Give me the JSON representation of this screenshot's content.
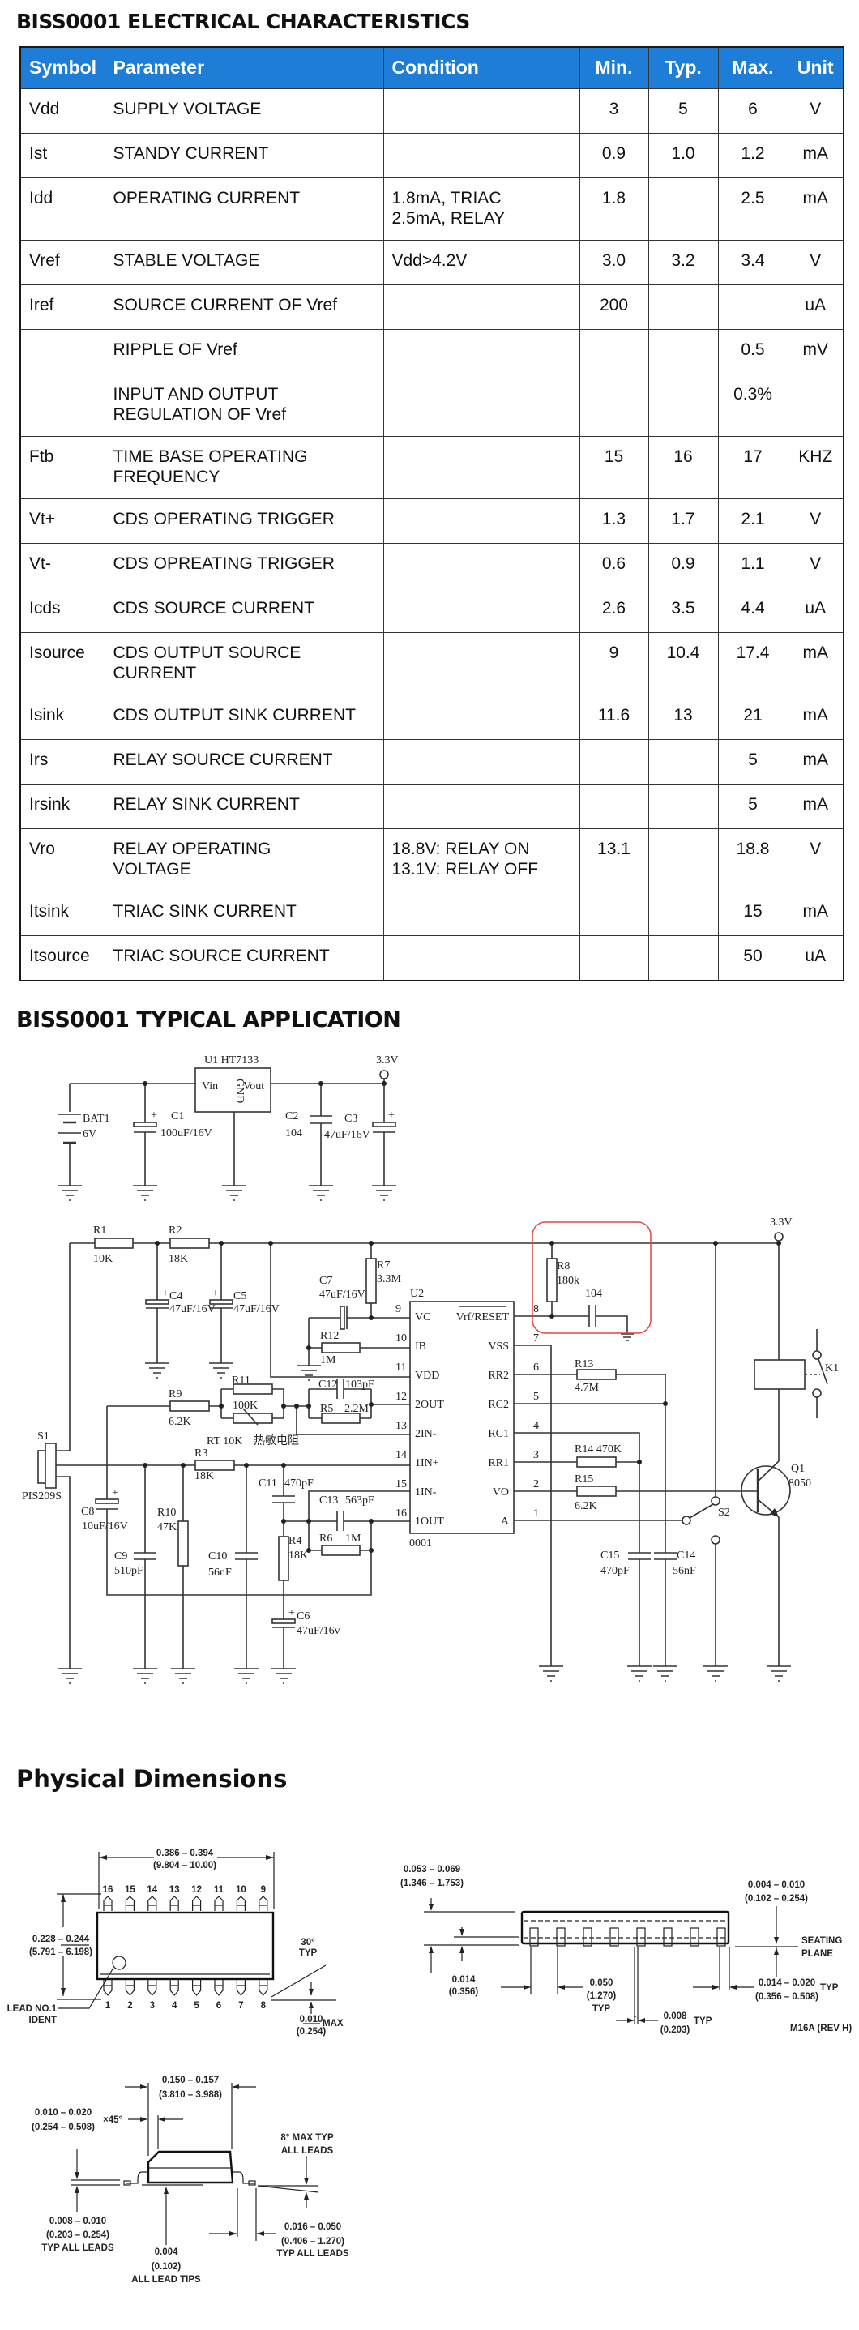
{
  "titles": {
    "electrical": "BISS0001 ELECTRICAL CHARACTERISTICS",
    "application": "BISS0001 TYPICAL APPLICATION",
    "dimensions": "Physical Dimensions"
  },
  "colors": {
    "header_bg": "#1e7dd7",
    "header_text": "#ffffff",
    "highlight_box": "#e0474c"
  },
  "table": {
    "headers": [
      "Symbol",
      "Parameter",
      "Condition",
      "Min.",
      "Typ.",
      "Max.",
      "Unit"
    ],
    "rows": [
      [
        "Vdd",
        "SUPPLY VOLTAGE",
        "",
        "3",
        "5",
        "6",
        "V"
      ],
      [
        "Ist",
        "STANDY CURRENT",
        "",
        "0.9",
        "1.0",
        "1.2",
        "mA"
      ],
      [
        "Idd",
        "OPERATING CURRENT",
        "1.8mA, TRIAC\n2.5mA, RELAY",
        "1.8",
        "",
        "2.5",
        "mA"
      ],
      [
        "Vref",
        "STABLE VOLTAGE",
        "Vdd>4.2V",
        "3.0",
        "3.2",
        "3.4",
        "V"
      ],
      [
        "Iref",
        "SOURCE CURRENT OF Vref",
        "",
        "200",
        "",
        "",
        "uA"
      ],
      [
        "",
        "RIPPLE OF Vref",
        "",
        "",
        "",
        "0.5",
        "mV"
      ],
      [
        "",
        "INPUT AND OUTPUT\nREGULATION OF Vref",
        "",
        "",
        "",
        "0.3%",
        ""
      ],
      [
        "Ftb",
        "TIME BASE OPERATING\nFREQUENCY",
        "",
        "15",
        "16",
        "17",
        "KHZ"
      ],
      [
        "Vt+",
        "CDS OPERATING TRIGGER",
        "",
        "1.3",
        "1.7",
        "2.1",
        "V"
      ],
      [
        "Vt-",
        "CDS OPREATING TRIGGER",
        "",
        "0.6",
        "0.9",
        "1.1",
        "V"
      ],
      [
        "Icds",
        "CDS SOURCE CURRENT",
        "",
        "2.6",
        "3.5",
        "4.4",
        "uA"
      ],
      [
        "Isource",
        "CDS OUTPUT SOURCE\nCURRENT",
        "",
        "9",
        "10.4",
        "17.4",
        "mA"
      ],
      [
        "Isink",
        "CDS OUTPUT SINK CURRENT",
        "",
        "11.6",
        "13",
        "21",
        "mA"
      ],
      [
        "Irs",
        "RELAY SOURCE CURRENT",
        "",
        "",
        "",
        "5",
        "mA"
      ],
      [
        "Irsink",
        "RELAY SINK CURRENT",
        "",
        "",
        "",
        "5",
        "mA"
      ],
      [
        "Vro",
        "RELAY OPERATING\nVOLTAGE",
        "18.8V: RELAY ON\n13.1V: RELAY OFF",
        "13.1",
        "",
        "18.8",
        "V"
      ],
      [
        "Itsink",
        "TRIAC SINK CURRENT",
        "",
        "",
        "",
        "15",
        "mA"
      ],
      [
        "Itsource",
        "TRIAC SOURCE CURRENT",
        "",
        "",
        "",
        "50",
        "uA"
      ]
    ]
  },
  "schematic": {
    "u1": "U1  HT7133",
    "vin": "Vin",
    "gnd": "GND",
    "vout": "Vout",
    "v33a": "3.3V",
    "v33b": "3.3V",
    "bat1": "BAT1",
    "bat1_v": "6V",
    "c1": "C1",
    "c1_v": "100uF/16V",
    "c2": "C2",
    "c2_v": "104",
    "c3": "C3",
    "c3_v": "47uF/16V",
    "r1": "R1",
    "r1_v": "10K",
    "r2": "R2",
    "r2_v": "18K",
    "c4": "C4",
    "c4_v": "47uF/16V",
    "c5": "C5",
    "c5_v": "47uF/16V",
    "r7": "R7",
    "r7_v": "3.3M",
    "c7": "C7",
    "c7_v": "47uF/16V",
    "r12": "R12",
    "r12_v": "1M",
    "r9": "R9",
    "r9_v": "6.2K",
    "r11": "R11",
    "r11_v": "100K",
    "rt": "RT 10K",
    "rt_cn": "热敏电阻",
    "c12": "C12",
    "c12_v": "103pF",
    "r5": "R5",
    "r5_v": "2.2M",
    "s1": "S1",
    "s1_v": "PIS209S",
    "r3": "R3",
    "r3_v": "18K",
    "c8": "C8",
    "c8_v": "10uF/16V",
    "c9": "C9",
    "c9_v": "510pF",
    "r10": "R10",
    "r10_v": "47K",
    "c10": "C10",
    "c10_v": "56nF",
    "c11": "C11",
    "c11_v": "470pF",
    "r4": "R4",
    "r4_v": "18K",
    "c6": "C6",
    "c6_v": "47uF/16v",
    "c13": "C13",
    "c13_v": "563pF",
    "r6": "R6",
    "r6_v": "1M",
    "u2": "U2",
    "u2_part": "0001",
    "pins_left": [
      {
        "num": "9",
        "name": "VC"
      },
      {
        "num": "10",
        "name": "IB"
      },
      {
        "num": "11",
        "name": "VDD"
      },
      {
        "num": "12",
        "name": "2OUT"
      },
      {
        "num": "13",
        "name": "2IN-"
      },
      {
        "num": "14",
        "name": "1IN+"
      },
      {
        "num": "15",
        "name": "1IN-"
      },
      {
        "num": "16",
        "name": "1OUT"
      }
    ],
    "pins_right": [
      {
        "num": "8",
        "name": "Vrf/RESET"
      },
      {
        "num": "7",
        "name": "VSS"
      },
      {
        "num": "6",
        "name": "RR2"
      },
      {
        "num": "5",
        "name": "RC2"
      },
      {
        "num": "4",
        "name": "RC1"
      },
      {
        "num": "3",
        "name": "RR1"
      },
      {
        "num": "2",
        "name": "VO"
      },
      {
        "num": "1",
        "name": "A"
      }
    ],
    "r8": "R8",
    "r8_v": "180k",
    "c_104": "104",
    "r13": "R13",
    "r13_v": "4.7M",
    "r14": "R14  470K",
    "r15": "R15",
    "r15_v": "6.2K",
    "c15": "C15",
    "c15_v": "470pF",
    "c14": "C14",
    "c14_v": "56nF",
    "s2": "S2",
    "k1": "K1",
    "q1": "Q1",
    "q1_v": "8050"
  },
  "dimensions": {
    "top_pins_upper": [
      "16",
      "15",
      "14",
      "13",
      "12",
      "11",
      "10",
      "9"
    ],
    "top_pins_lower": [
      "1",
      "2",
      "3",
      "4",
      "5",
      "6",
      "7",
      "8"
    ],
    "length_in": "0.386 – 0.394",
    "length_mm": "(9.804 – 10.00)",
    "width_in": "0.228 – 0.244",
    "width_mm": "(5.791 – 6.198)",
    "lead1_a": "LEAD NO.1",
    "lead1_b": "IDENT",
    "angle_a": "30°",
    "angle_b": "TYP",
    "max_in": "0.010",
    "max_word": "MAX",
    "max_mm": "(0.254)",
    "height_in": "0.053 – 0.069",
    "height_mm": "(1.346 – 1.753)",
    "standoff_in": "0.004 – 0.010",
    "standoff_mm": "(0.102 – 0.254)",
    "seating_a": "SEATING",
    "seating_b": "PLANE",
    "s014_in": "0.014",
    "s014_mm": "(0.356)",
    "pitch_in": "0.050",
    "pitch_mm": "(1.270)",
    "pitch_typ": "TYP",
    "s008_in": "0.008",
    "s008_mm": "(0.203)",
    "s008_typ": "TYP",
    "lead_w_in": "0.014 – 0.020",
    "lead_w_mm": "(0.356 – 0.508)",
    "lead_w_typ": "TYP",
    "rev": "M16A (REV H)",
    "body_in": "0.150 – 0.157",
    "body_mm": "(3.810 – 3.988)",
    "chamfer_in": "0.010 – 0.020",
    "chamfer_mm": "(0.254 – 0.508)",
    "chamfer_x": "×45°",
    "angle8_a": "8° MAX TYP",
    "angle8_b": "ALL LEADS",
    "thick_in": "0.008 – 0.010",
    "thick_mm": "(0.203 – 0.254)",
    "thick_typ": "TYP ALL LEADS",
    "tips_in": "0.004",
    "tips_mm": "(0.102)",
    "tips_txt": "ALL LEAD TIPS",
    "foot_in": "0.016 – 0.050",
    "foot_mm": "(0.406 – 1.270)",
    "foot_typ": "TYP ALL LEADS"
  }
}
